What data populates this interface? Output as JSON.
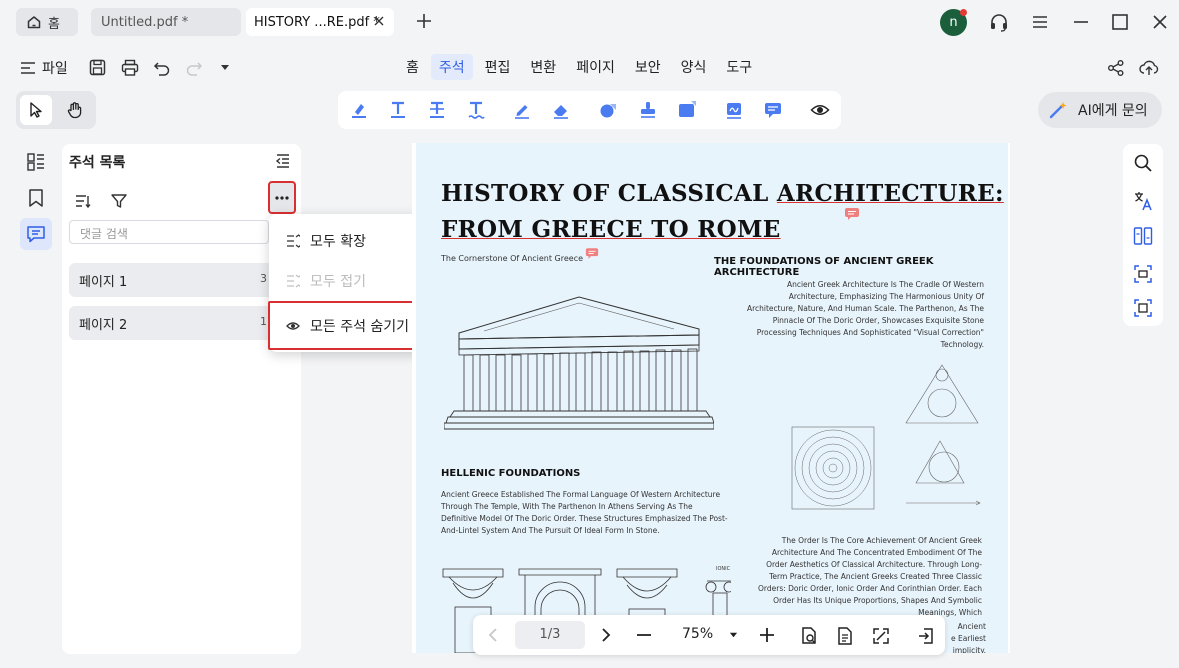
{
  "tabs": {
    "home_label": "홈",
    "untitled_label": "Untitled.pdf *",
    "active_label": "HISTORY ...RE.pdf *"
  },
  "user": {
    "avatar_letter": "n"
  },
  "menu": {
    "file_label": "파일",
    "nav_tabs": [
      "홈",
      "주석",
      "편집",
      "변환",
      "페이지",
      "보안",
      "양식",
      "도구"
    ],
    "active_tab": "주석"
  },
  "toolbar": {
    "ai_label": "AI에게 문의"
  },
  "comments_panel": {
    "title": "주석 목록",
    "search_placeholder": "댓글 검색",
    "pages": [
      {
        "label": "페이지 1",
        "count": "3"
      },
      {
        "label": "페이지 2",
        "count": "1"
      }
    ]
  },
  "dropdown": {
    "expand_all": "모두 확장",
    "collapse_all": "모두 접기",
    "hide_all": "모든 주석 숨기기"
  },
  "document": {
    "title_line1_a": "HISTORY OF CLASSICAL ",
    "title_line1_b": "ARCHITECTURE:",
    "title_line2": "FROM GREECE TO ROME",
    "subtitle": "The Cornerstone Of Ancient Greece",
    "section1_title": "THE FOUNDATIONS OF ANCIENT GREEK ARCHITECTURE",
    "section1_text": "Ancient Greek Architecture Is The Cradle Of Western Architecture, Emphasizing The Harmonious Unity Of Architecture, Nature, And Human Scale. The Parthenon, As The Pinnacle Of The Doric Order, Showcases Exquisite Stone Processing Techniques And Sophisticated \"Visual Correction\" Technology.",
    "section2_title": "HELLENIC FOUNDATIONS",
    "section2_text": "Ancient Greece Established The Formal Language Of Western Architecture Through The Temple, With The Parthenon In Athens Serving As The Definitive Model Of The Doric Order. These Structures Emphasized The Post-And-Lintel System And The Pursuit Of Ideal Form In Stone.",
    "section3_text": "The Order Is The Core Achievement Of Ancient Greek Architecture And The Concentrated Embodiment Of The Order Aesthetics Of Classical Architecture. Through Long-Term Practice, The Ancient Greeks Created Three Classic Orders: Doric Order, Ionic Order And Corinthian Order. Each Order Has Its Unique Proportions, Shapes And Symbolic Meanings, Which",
    "section3_tail": [
      "Ancient",
      "e Earliest",
      "implicity."
    ],
    "ionic_label": "IONIC"
  },
  "bottom_bar": {
    "page_indicator": "1/3",
    "zoom": "75%"
  },
  "colors": {
    "accent": "#2f5ee6",
    "highlight_border": "#d83030",
    "page_bg": "#e8f4fc",
    "avatar_bg": "#1b5e3c"
  }
}
